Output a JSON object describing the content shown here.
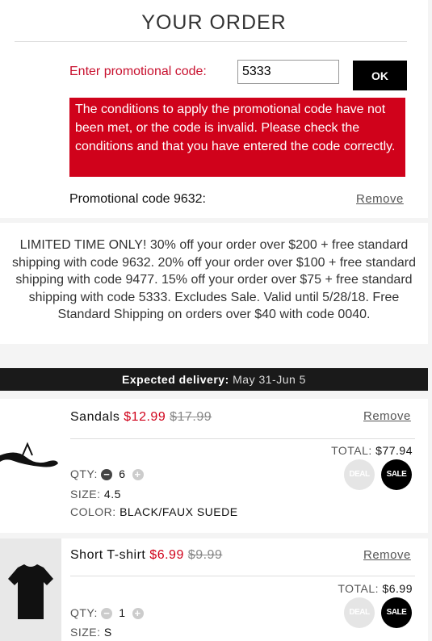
{
  "header": {
    "title": "YOUR ORDER"
  },
  "promo": {
    "label": "Enter promotional code:",
    "input_value": "5333",
    "ok_label": "OK",
    "error": "The conditions to apply the promotional code have not been met, or the code is invalid. Please check the conditions and that you have entered the code correctly.",
    "applied_label": "Promotional code 9632:",
    "remove_label": "Remove"
  },
  "notice": {
    "text": "LIMITED TIME ONLY! 30% off your order over $200 + free standard shipping with code 9632. 20% off your order over $100 + free standard shipping with code 9477. 15% off your order over $75 + free standard shipping with code 5333. Excludes Sale. Valid until 5/28/18. Free Standard Shipping on orders over $40 with code 0040."
  },
  "delivery": {
    "label": "Expected delivery:",
    "dates": "May 31-Jun 5"
  },
  "items": [
    {
      "name": "Sandals",
      "sale_price": "$12.99",
      "orig_price": "$17.99",
      "remove_label": "Remove",
      "total_label": "TOTAL:",
      "total_value": "$77.94",
      "qty_label": "QTY:",
      "qty": "6",
      "size_label": "SIZE:",
      "size": "4.5",
      "color_label": "COLOR:",
      "color": "BLACK/FAUX SUEDE",
      "deal_badge": "DEAL",
      "sale_badge": "SALE"
    },
    {
      "name": "Short T-shirt",
      "sale_price": "$6.99",
      "orig_price": "$9.99",
      "remove_label": "Remove",
      "total_label": "TOTAL:",
      "total_value": "$6.99",
      "qty_label": "QTY:",
      "qty": "1",
      "size_label": "SIZE:",
      "size": "S",
      "deal_badge": "DEAL",
      "sale_badge": "SALE"
    }
  ],
  "colors": {
    "accent_red": "#d0021b",
    "black": "#000000",
    "delivery_bar": "#1a1a1a"
  }
}
